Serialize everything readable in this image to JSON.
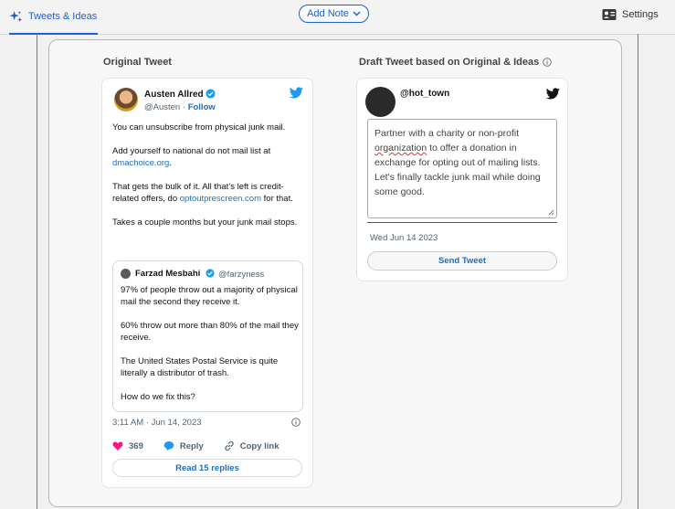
{
  "topbar": {
    "tab_label": "Tweets & Ideas",
    "add_note_label": "Add Note",
    "settings_label": "Settings"
  },
  "sections": {
    "original_title": "Original Tweet",
    "draft_title": "Draft Tweet based on Original & Ideas"
  },
  "tweet": {
    "author_name": "Austen Allred",
    "handle": "@Austen",
    "separator": "·",
    "follow_label": "Follow",
    "p1": "You can unsubscribe from physical junk mail.",
    "p2_text": "Add yourself to national do not mail list at",
    "p2_link": "dmachoice.org",
    "p2_end": ".",
    "p3_text": "That gets the bulk of it. All that’s left is credit-related offers, do",
    "p3_link": "optoutprescreen.com",
    "p3_end": "for that.",
    "p4": "Takes a couple months but your junk mail stops.",
    "quote": {
      "author_name": "Farzad Mesbahi",
      "handle": "@farzyness",
      "p1": "97% of people throw out a majority of physical mail the second they receive it.",
      "p2": "60% throw out more than 80% of the mail they receive.",
      "p3": "The United States Postal Service is quite literally a distributor of trash.",
      "p4": "How do we fix this?"
    },
    "timestamp": "3:11 AM · Jun 14, 2023",
    "likes": "369",
    "reply_label": "Reply",
    "copy_link_label": "Copy link",
    "read_replies_label": "Read 15 replies"
  },
  "draft": {
    "handle": "@hot_town",
    "text_before": "Partner with a charity or non-profit ",
    "text_misspelled": "organization",
    "text_after": " to offer a donation in exchange for opting out of mailing lists. Let's finally tackle junk mail while doing some good.",
    "date": "Wed Jun 14 2023",
    "send_label": "Send Tweet"
  },
  "colors": {
    "accent": "#1d5fd6",
    "link": "#1d6fbd",
    "twitter_blue": "#1d9bf0",
    "like_pink": "#f91880"
  },
  "icons": {
    "tab": "sparkles-icon",
    "add_note": "chevron-down-icon",
    "settings": "id-card-icon",
    "info": "info-icon",
    "twitter": "twitter-bird-icon",
    "verified": "verified-badge-icon",
    "like": "heart-icon",
    "reply": "speech-bubble-icon",
    "copy_link": "link-icon"
  }
}
